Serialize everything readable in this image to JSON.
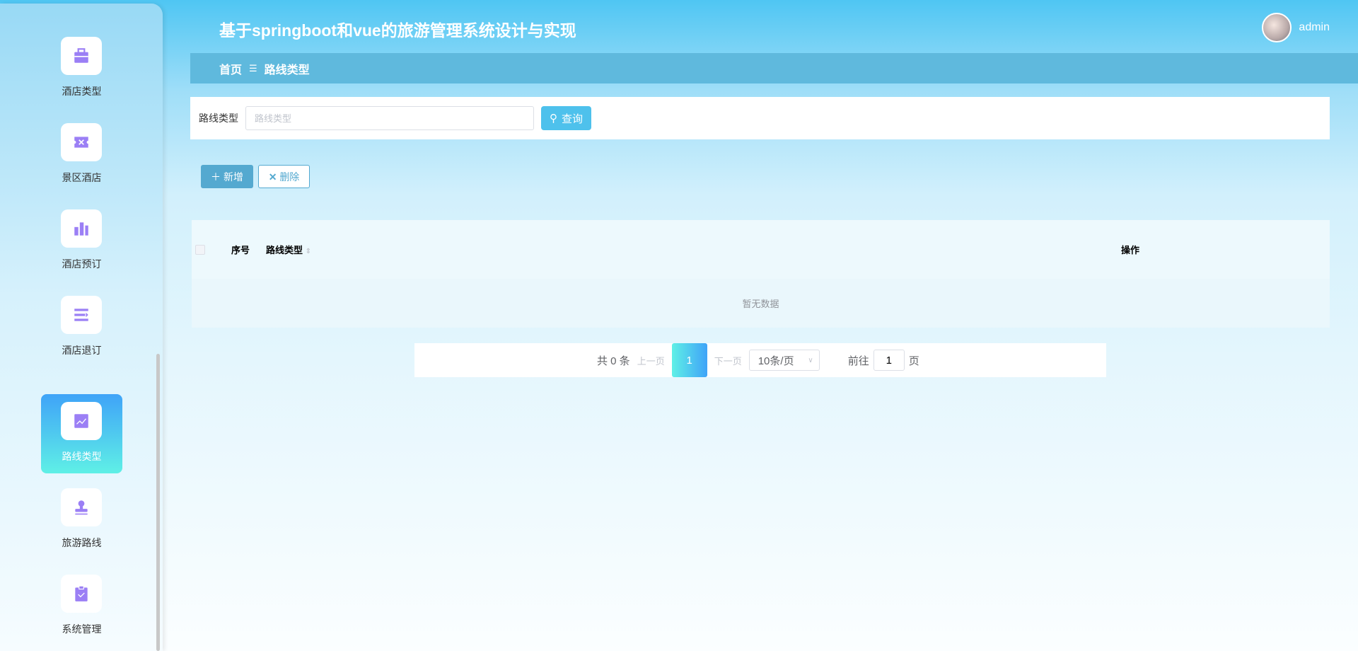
{
  "header": {
    "title": "基于springboot和vue的旅游管理系统设计与实现",
    "username": "admin"
  },
  "sidebar": {
    "items": [
      {
        "label": "酒店类型",
        "icon": "briefcase-icon"
      },
      {
        "label": "景区酒店",
        "icon": "ticket-icon"
      },
      {
        "label": "酒店预订",
        "icon": "bar-chart-icon"
      },
      {
        "label": "酒店退订",
        "icon": "list-icon"
      },
      {
        "label": "路线类型",
        "icon": "trend-chart-icon",
        "active": true
      },
      {
        "label": "旅游路线",
        "icon": "stamp-icon"
      },
      {
        "label": "系统管理",
        "icon": "clipboard-check-icon"
      }
    ]
  },
  "breadcrumb": {
    "home": "首页",
    "separator": "☰",
    "current": "路线类型"
  },
  "search": {
    "label": "路线类型",
    "placeholder": "路线类型",
    "value": "",
    "button": "查询"
  },
  "actions": {
    "add": "新增",
    "delete": "删除"
  },
  "table": {
    "columns": [
      "序号",
      "路线类型",
      "操作"
    ],
    "empty_text": "暂无数据"
  },
  "pagination": {
    "total": "共 0 条",
    "prev": "上一页",
    "current": "1",
    "next": "下一页",
    "page_size": "10条/页",
    "goto_label": "前往",
    "goto_value": "1",
    "goto_suffix": "页"
  },
  "colors": {
    "accent": "#54a9d0",
    "icon": "#9b7ff5"
  }
}
